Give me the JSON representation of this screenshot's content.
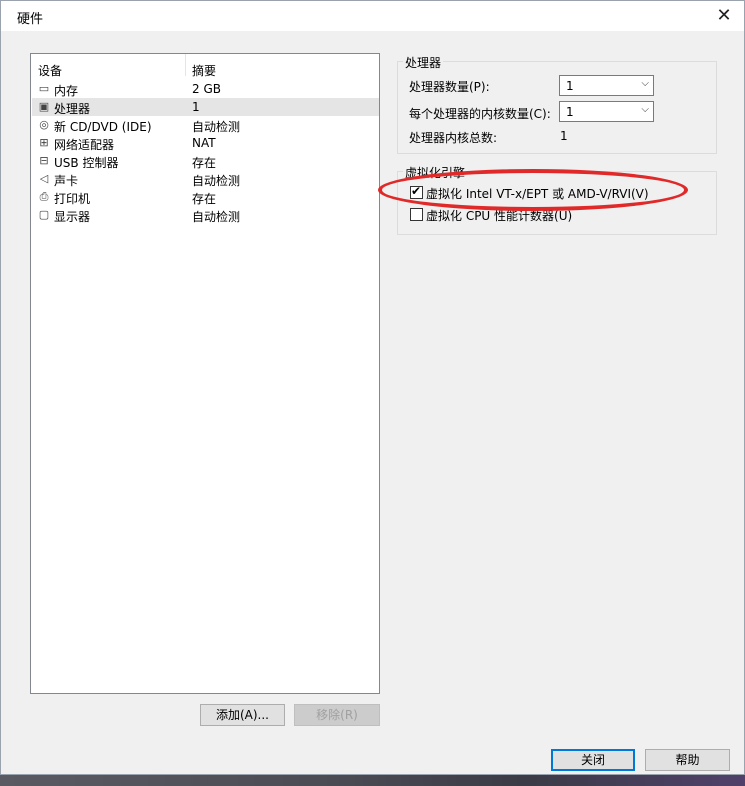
{
  "window": {
    "title": "硬件",
    "close_glyph": "✕"
  },
  "device_list": {
    "col_device": "设备",
    "col_summary": "摘要",
    "items": [
      {
        "icon": "memory-icon",
        "glyph": "▭",
        "name": "内存",
        "summary": "2 GB",
        "selected": false
      },
      {
        "icon": "processor-icon",
        "glyph": "▣",
        "name": "处理器",
        "summary": "1",
        "selected": true
      },
      {
        "icon": "cd-dvd-icon",
        "glyph": "◎",
        "name": "新 CD/DVD (IDE)",
        "summary": "自动检测",
        "selected": false
      },
      {
        "icon": "network-adapter-icon",
        "glyph": "⊞",
        "name": "网络适配器",
        "summary": "NAT",
        "selected": false
      },
      {
        "icon": "usb-icon",
        "glyph": "⊟",
        "name": "USB 控制器",
        "summary": "存在",
        "selected": false
      },
      {
        "icon": "sound-card-icon",
        "glyph": "◁",
        "name": "声卡",
        "summary": "自动检测",
        "selected": false
      },
      {
        "icon": "printer-icon",
        "glyph": "⎙",
        "name": "打印机",
        "summary": "存在",
        "selected": false
      },
      {
        "icon": "display-icon",
        "glyph": "▢",
        "name": "显示器",
        "summary": "自动检测",
        "selected": false
      }
    ]
  },
  "buttons": {
    "add": "添加(A)...",
    "remove": "移除(R)",
    "close": "关闭",
    "help": "帮助"
  },
  "processor_group": {
    "title": "处理器",
    "count_label": "处理器数量(P):",
    "count_value": "1",
    "cores_label": "每个处理器的内核数量(C):",
    "cores_value": "1",
    "total_label": "处理器内核总数:",
    "total_value": "1"
  },
  "virtualization_group": {
    "title": "虚拟化引擎",
    "option1_label": "虚拟化 Intel VT-x/EPT 或 AMD-V/RVI(V)",
    "option1_checked": true,
    "option2_label": "虚拟化 CPU 性能计数器(U)",
    "option2_checked": false
  },
  "colors": {
    "highlight_ring": "#e02a2a",
    "focus_border": "#0078d7"
  }
}
